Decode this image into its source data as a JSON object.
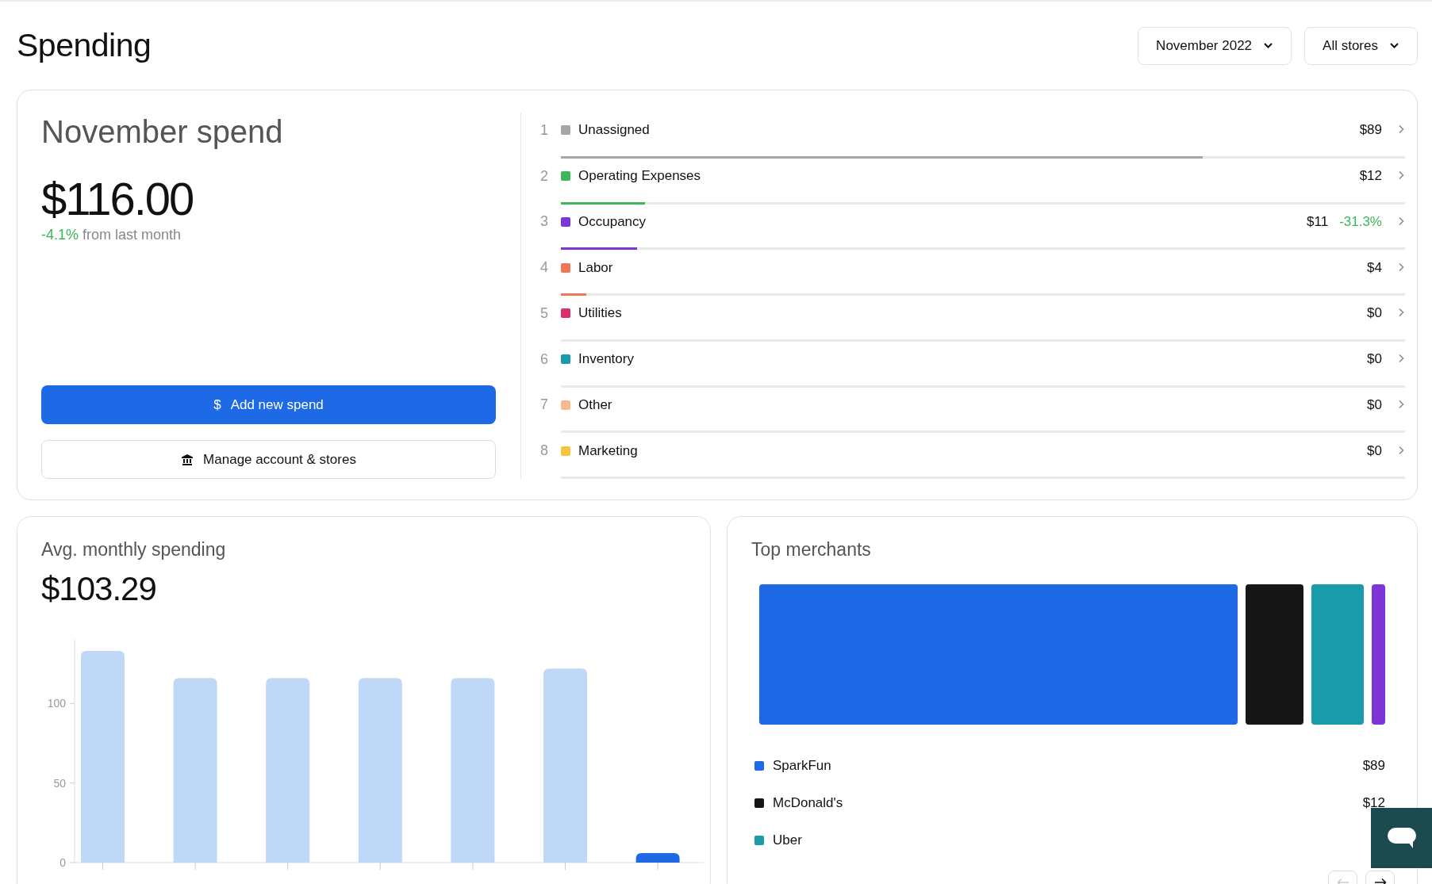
{
  "page": {
    "title": "Spending"
  },
  "filters": [
    {
      "label": "November 2022"
    },
    {
      "label": "All stores"
    }
  ],
  "summary": {
    "title": "November spend",
    "amount": "$116.00",
    "change": "-4.1%",
    "change_note": "from last month",
    "buttons": [
      {
        "kind": "primary",
        "icon": "$",
        "label": "Add new spend"
      },
      {
        "kind": "secondary",
        "label": "Manage account & stores"
      }
    ]
  },
  "categories": [
    {
      "rank": "1",
      "name": "Unassigned",
      "color": "#a6a6a6",
      "amount": "$89",
      "level": 0.76
    },
    {
      "rank": "2",
      "name": "Operating Expenses",
      "color": "#3db55b",
      "amount": "$12",
      "level": 0.1
    },
    {
      "rank": "3",
      "name": "Occupancy",
      "color": "#7d35d8",
      "amount": "$11",
      "change": "-31.3%",
      "level": 0.09
    },
    {
      "rank": "4",
      "name": "Labor",
      "color": "#ef7656",
      "amount": "$4",
      "level": 0.03
    },
    {
      "rank": "5",
      "name": "Utilities",
      "color": "#d92f6f",
      "amount": "$0",
      "level": 0
    },
    {
      "rank": "6",
      "name": "Inventory",
      "color": "#1a9bab",
      "amount": "$0",
      "level": 0
    },
    {
      "rank": "7",
      "name": "Other",
      "color": "#f8b98f",
      "amount": "$0",
      "level": 0
    },
    {
      "rank": "8",
      "name": "Marketing",
      "color": "#f6c53a",
      "amount": "$0",
      "level": 0
    }
  ],
  "avg_spending": {
    "title": "Avg. monthly spending",
    "amount": "$103.29",
    "chart_data": {
      "type": "bar",
      "values": [
        133,
        116,
        116,
        116,
        116,
        122,
        6
      ],
      "ylim": [
        0,
        140
      ],
      "yticks": [
        0,
        50,
        100
      ]
    }
  },
  "top_merchants": {
    "title": "Top merchants",
    "merchants": [
      {
        "name": "SparkFun",
        "color": "#1d69e6",
        "amount": "$89"
      },
      {
        "name": "McDonald's",
        "color": "#161616",
        "amount": "$12"
      },
      {
        "name": "Uber",
        "color": "#1a9bab"
      }
    ]
  }
}
